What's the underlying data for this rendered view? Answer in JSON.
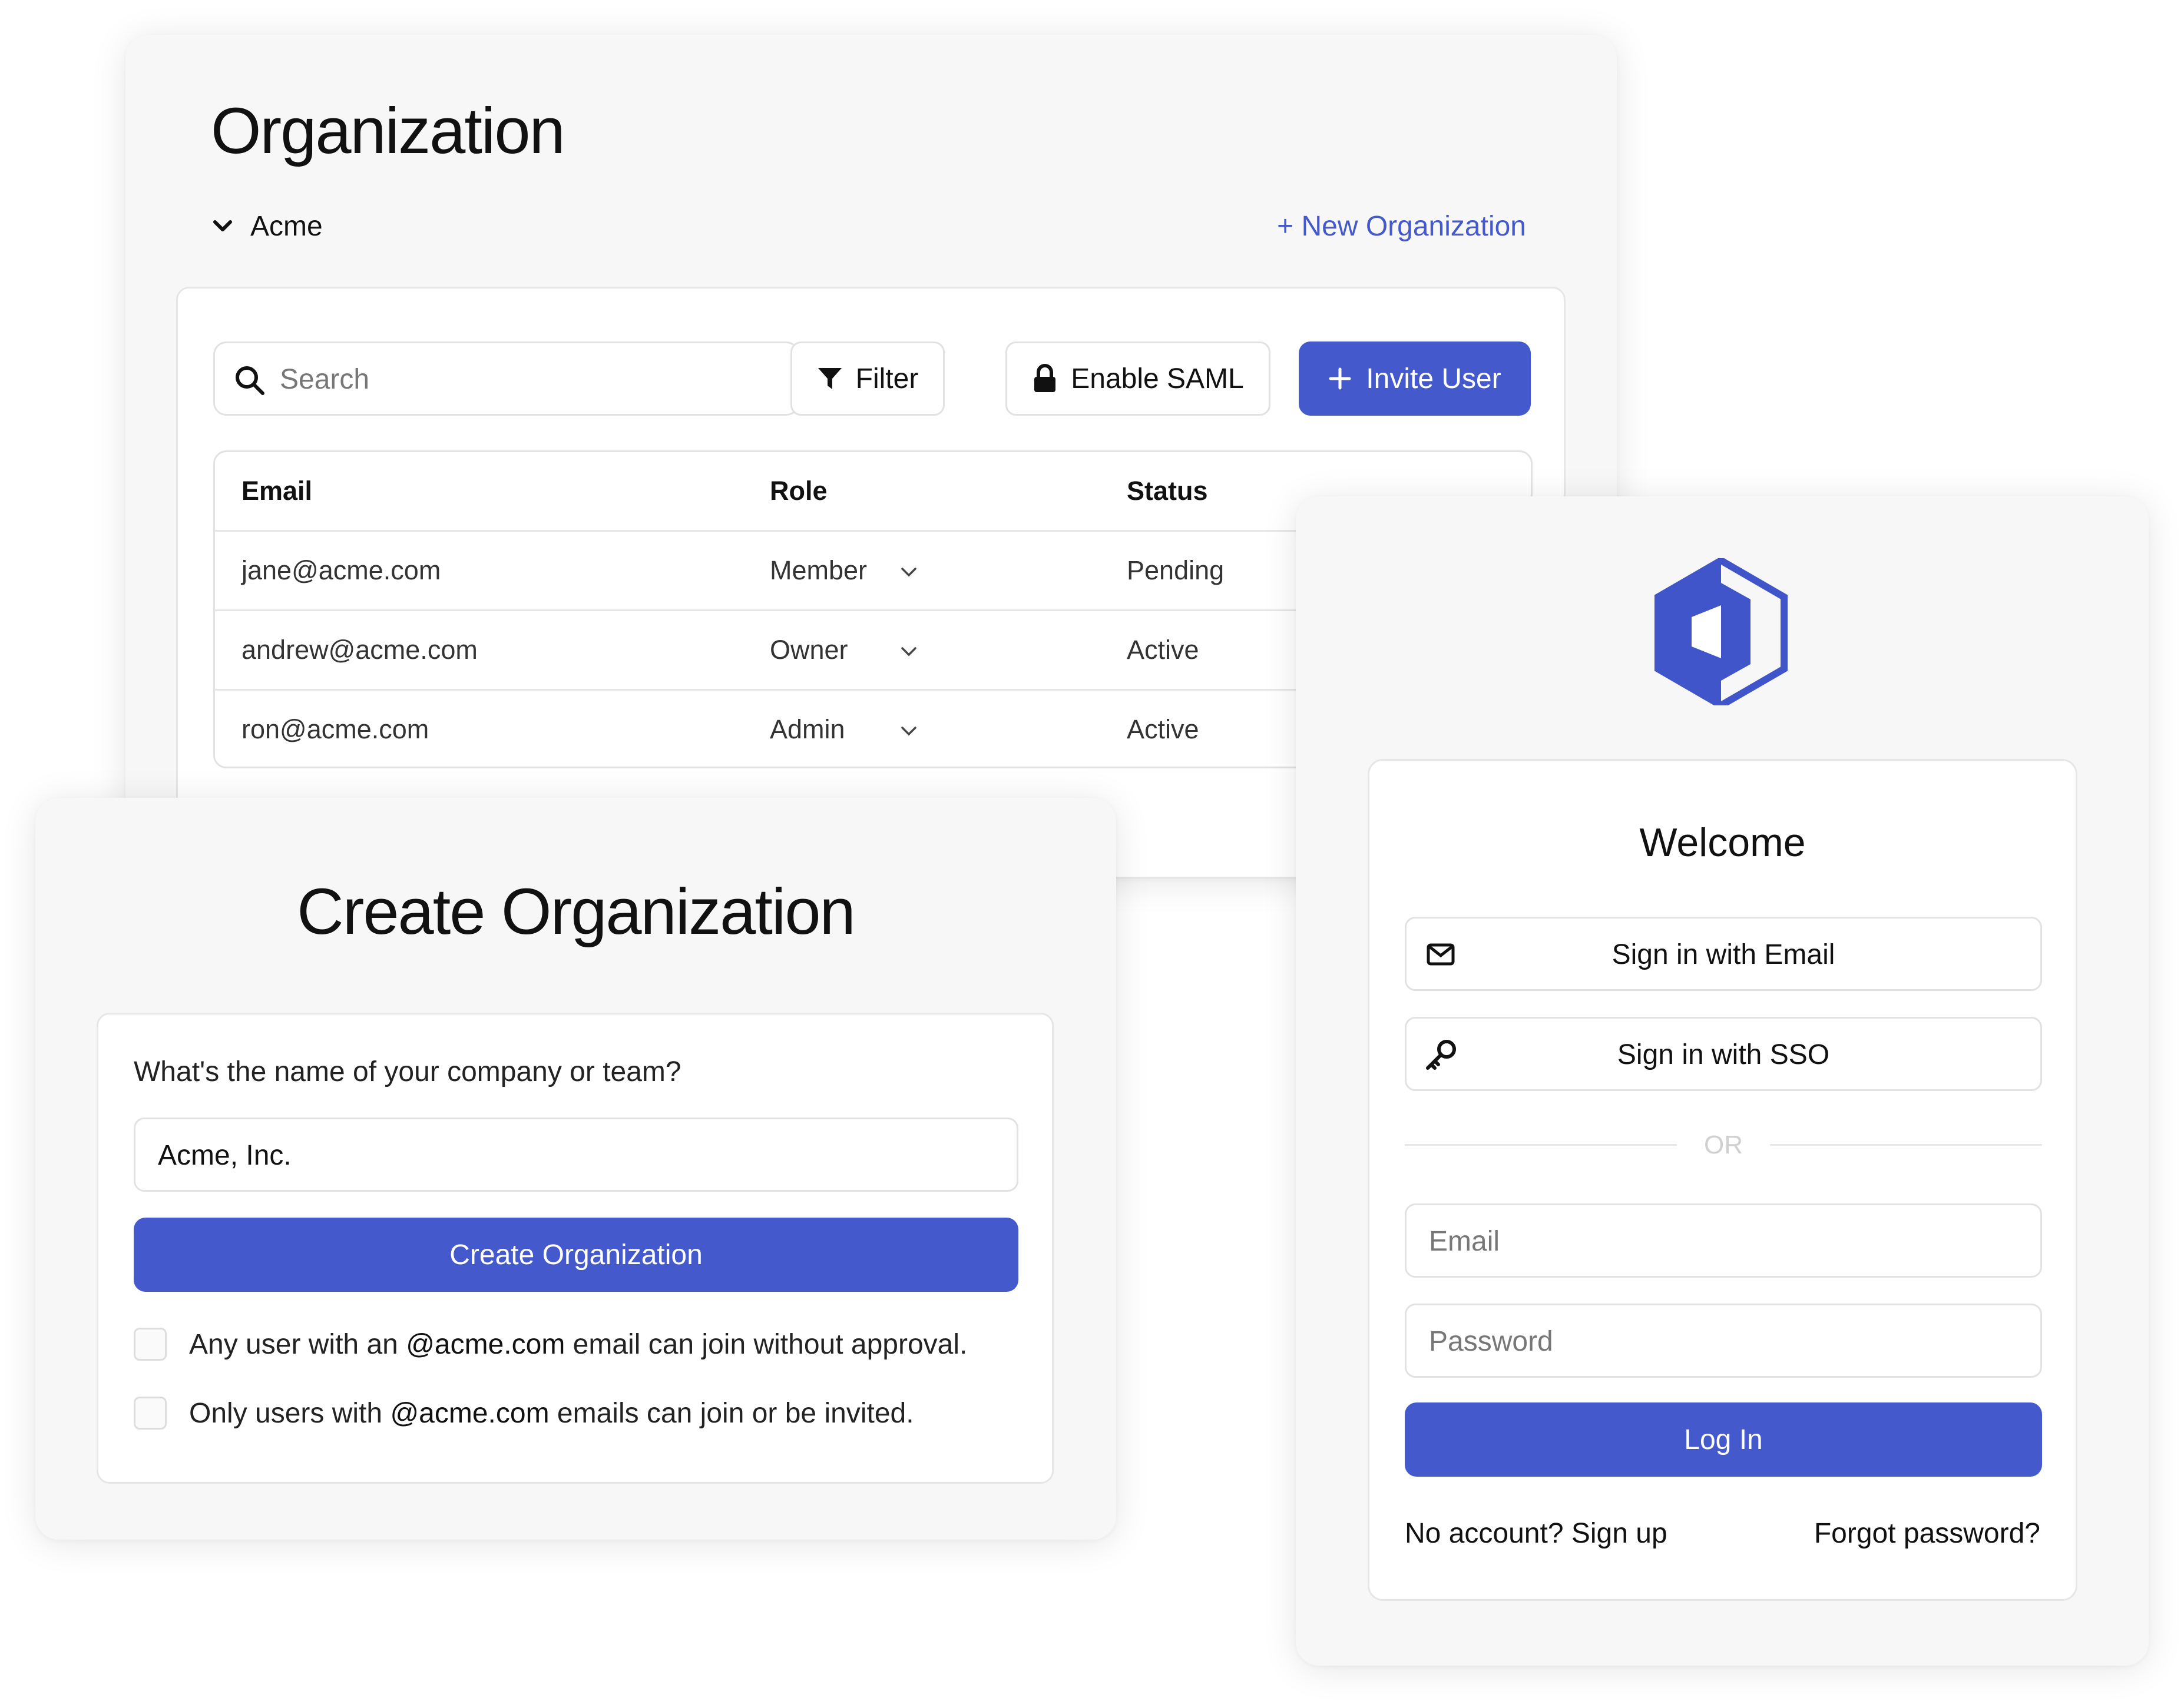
{
  "organization_panel": {
    "title": "Organization",
    "org_selector": "Acme",
    "new_org_link": "+ New Organization",
    "toolbar": {
      "search_placeholder": "Search",
      "filter_label": "Filter",
      "saml_label": "Enable SAML",
      "invite_label": "Invite User"
    },
    "table": {
      "headers": [
        "Email",
        "Role",
        "Status"
      ],
      "rows": [
        {
          "email": "jane@acme.com",
          "role": "Member",
          "status": "Pending"
        },
        {
          "email": "andrew@acme.com",
          "role": "Owner",
          "status": "Active"
        },
        {
          "email": "ron@acme.com",
          "role": "Admin",
          "status": "Active"
        }
      ]
    }
  },
  "create_org_panel": {
    "title": "Create Organization",
    "question": "What's the name of your company or team?",
    "input_value": "Acme, Inc.",
    "submit_label": "Create Organization",
    "options": [
      {
        "pre": "Any user with an ",
        "domain": "@acme.com",
        "post": " email can join without approval."
      },
      {
        "pre": "Only users with ",
        "domain": "@acme.com",
        "post": " emails can join or be invited."
      }
    ]
  },
  "login_panel": {
    "welcome": "Welcome",
    "sign_in_email": "Sign in with Email",
    "sign_in_sso": "Sign in with SSO",
    "divider": "OR",
    "email_placeholder": "Email",
    "password_placeholder": "Password",
    "login_label": "Log In",
    "signup_link": "No account? Sign up",
    "forgot_link": "Forgot password?"
  },
  "colors": {
    "accent": "#4459cb",
    "logo": "#3f55c9"
  }
}
